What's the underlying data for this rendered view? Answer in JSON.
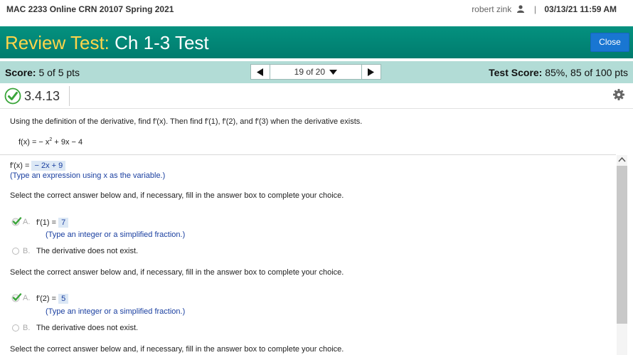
{
  "header": {
    "course": "MAC 2233 Online CRN 20107 Spring 2021",
    "user_name": "robert zink",
    "separator": "|",
    "datetime": "03/13/21 11:59 AM"
  },
  "titlebar": {
    "prefix": "Review Test:",
    "title": "Ch 1-3 Test",
    "close_label": "Close"
  },
  "scorebar": {
    "score_label": "Score:",
    "score_value": "5 of 5 pts",
    "question_position": "19 of 20",
    "test_score_label": "Test Score:",
    "test_score_value": "85%, 85 of 100 pts"
  },
  "question": {
    "id": "3.4.13",
    "prompt": "Using the definition of the derivative, find f′(x). Then find f′(1), f′(2), and f′(3) when the derivative exists.",
    "function_lhs": "f(x) = − x",
    "function_exp": "2",
    "function_rhs": " + 9x − 4"
  },
  "part1": {
    "label": "f′(x) = ",
    "answer": "− 2x + 9",
    "hint": "(Type an expression using x as the variable.)"
  },
  "instruction": "Select the correct answer below and, if necessary, fill in the answer box to complete your choice.",
  "part2": {
    "option_a_letter": "A.",
    "option_a_label": "f′(1) = ",
    "option_a_answer": "7",
    "option_a_hint": "(Type an integer or a simplified fraction.)",
    "option_b_letter": "B.",
    "option_b_label": "The derivative does not exist."
  },
  "part3": {
    "option_a_letter": "A.",
    "option_a_label": "f′(2) = ",
    "option_a_answer": "5",
    "option_a_hint": "(Type an integer or a simplified fraction.)",
    "option_b_letter": "B.",
    "option_b_label": "The derivative does not exist."
  },
  "icons": {
    "correct": "check-circle-icon",
    "settings": "gear-icon",
    "user": "person-icon",
    "prev": "triangle-left-icon",
    "next": "triangle-right-icon",
    "dropdown": "triangle-down-icon"
  },
  "colors": {
    "title_bar": "#00897b",
    "title_prefix": "#ffd54a",
    "score_bar": "#b2dcd6",
    "close_button": "#1976d2",
    "correct_green": "#3aa53a",
    "hint_blue": "#1a3fa0",
    "answer_box": "#dce8f5"
  }
}
